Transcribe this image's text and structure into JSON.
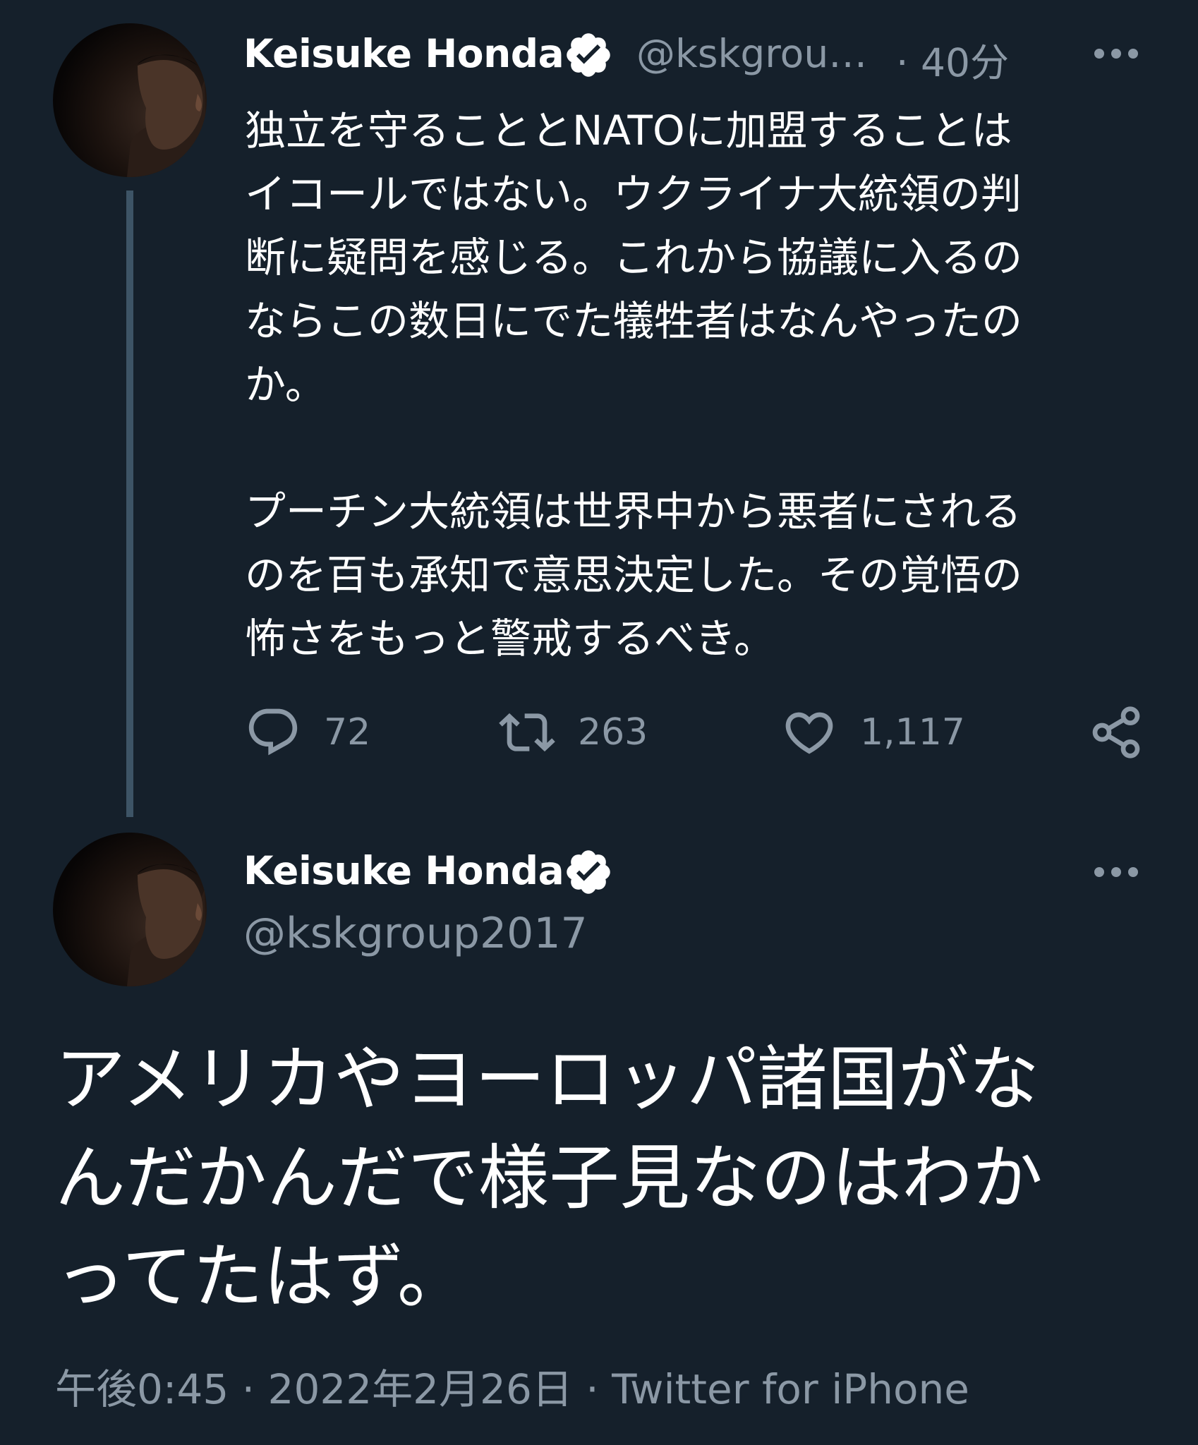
{
  "tweet1": {
    "author_name": "Keisuke Honda",
    "handle": "@kskgrou…",
    "time": "· 40分",
    "text_lines": [
      "独立を守ることとNATOに加盟することは",
      "イコールではない。ウクライナ大統領の判",
      "断に疑問を感じる。これから協議に入るの",
      "ならこの数日にでた犠牲者はなんやったの",
      "か。",
      "",
      "プーチン大統領は世界中から悪者にされる",
      "のを百も承知で意思決定した。その覚悟の",
      "怖さをもっと警戒するべき。"
    ],
    "reply_count": "72",
    "retweet_count": "263",
    "like_count": "1,117"
  },
  "tweet2": {
    "author_name": "Keisuke Honda",
    "handle": "@kskgroup2017",
    "text_lines": [
      "アメリカやヨーロッパ諸国がな",
      "んだかんだで様子見なのはわか",
      "ってたはず。"
    ],
    "meta": "午後0:45 · 2022年2月26日 · Twitter for iPhone"
  },
  "icons": {
    "verified": "verified-badge-icon",
    "more": "more-horizontal-icon",
    "reply": "reply-icon",
    "retweet": "retweet-icon",
    "like": "heart-icon",
    "share": "share-icon"
  },
  "colors": {
    "background": "#15202b",
    "text": "#ffffff",
    "secondary_text": "#8b98a5",
    "thread_line": "#3d5466"
  }
}
